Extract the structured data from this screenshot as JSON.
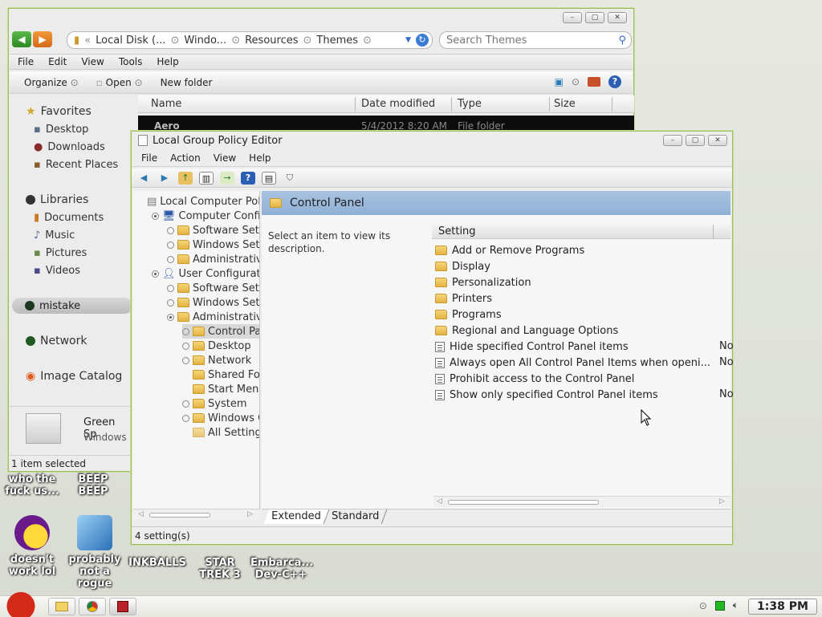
{
  "explorer": {
    "address": [
      "Local Disk (...",
      "Windo...",
      "Resources",
      "Themes"
    ],
    "search_placeholder": "Search Themes",
    "menu": [
      "File",
      "Edit",
      "View",
      "Tools",
      "Help"
    ],
    "toolbar": {
      "organize": "Organize",
      "open": "Open",
      "new_folder": "New folder"
    },
    "nav": {
      "favorites": "Favorites",
      "desktop": "Desktop",
      "downloads": "Downloads",
      "recent": "Recent Places",
      "libraries": "Libraries",
      "documents": "Documents",
      "music": "Music",
      "pictures": "Pictures",
      "videos": "Videos",
      "mistake": "mistake",
      "network": "Network",
      "image_catalog": "Image Catalog"
    },
    "columns": {
      "name": "Name",
      "date": "Date modified",
      "type": "Type",
      "size": "Size"
    },
    "row": {
      "name": "Aero",
      "date": "5/4/2012 8:20 AM",
      "type": "File folder"
    },
    "details": {
      "name": "Green Sp",
      "sub": "Windows"
    },
    "status": "1 item selected"
  },
  "gpe": {
    "title": "Local Group Policy Editor",
    "menu": [
      "File",
      "Action",
      "View",
      "Help"
    ],
    "tree": [
      {
        "label": "Local Computer Poli",
        "indent": 0,
        "toggle": "none",
        "icon": "doc"
      },
      {
        "label": "Computer Configu",
        "indent": 1,
        "toggle": "dot",
        "icon": "pc"
      },
      {
        "label": "Software Setti",
        "indent": 2,
        "toggle": "open",
        "icon": "folder"
      },
      {
        "label": "Windows Setti",
        "indent": 2,
        "toggle": "open",
        "icon": "folder"
      },
      {
        "label": "Administrative",
        "indent": 2,
        "toggle": "open",
        "icon": "folder"
      },
      {
        "label": "User Configuratio",
        "indent": 1,
        "toggle": "dot",
        "icon": "user"
      },
      {
        "label": "Software Setti",
        "indent": 2,
        "toggle": "open",
        "icon": "folder"
      },
      {
        "label": "Windows Setti",
        "indent": 2,
        "toggle": "open",
        "icon": "folder"
      },
      {
        "label": "Administrative",
        "indent": 2,
        "toggle": "dot",
        "icon": "folder"
      },
      {
        "label": "Control Par",
        "indent": 3,
        "toggle": "open",
        "icon": "folder",
        "selected": true
      },
      {
        "label": "Desktop",
        "indent": 3,
        "toggle": "open",
        "icon": "folder"
      },
      {
        "label": "Network",
        "indent": 3,
        "toggle": "open",
        "icon": "folder"
      },
      {
        "label": "Shared Fol",
        "indent": 3,
        "toggle": "none",
        "icon": "folder"
      },
      {
        "label": "Start Menu",
        "indent": 3,
        "toggle": "none",
        "icon": "folder"
      },
      {
        "label": "System",
        "indent": 3,
        "toggle": "open",
        "icon": "folder"
      },
      {
        "label": "Windows C",
        "indent": 3,
        "toggle": "open",
        "icon": "folder"
      },
      {
        "label": "All Settings",
        "indent": 3,
        "toggle": "none",
        "icon": "allsettings"
      }
    ],
    "panel_title": "Control Panel",
    "description": "Select an item to view its description.",
    "setting_header": "Setting",
    "settings": [
      {
        "label": "Add or Remove Programs",
        "kind": "folder",
        "state": ""
      },
      {
        "label": "Display",
        "kind": "folder",
        "state": ""
      },
      {
        "label": "Personalization",
        "kind": "folder",
        "state": ""
      },
      {
        "label": "Printers",
        "kind": "folder",
        "state": ""
      },
      {
        "label": "Programs",
        "kind": "folder",
        "state": ""
      },
      {
        "label": "Regional and Language Options",
        "kind": "folder",
        "state": ""
      },
      {
        "label": "Hide specified Control Panel items",
        "kind": "policy",
        "state": "No"
      },
      {
        "label": "Always open All Control Panel Items when openi...",
        "kind": "policy",
        "state": "No"
      },
      {
        "label": "Prohibit access to the Control Panel",
        "kind": "policy",
        "state": ""
      },
      {
        "label": "Show only specified Control Panel items",
        "kind": "policy",
        "state": "No"
      }
    ],
    "tabs": [
      "Extended",
      "Standard"
    ],
    "status": "4 setting(s)"
  },
  "desktop": {
    "icons": [
      {
        "label": "who the fuck us..."
      },
      {
        "label": "BEEP BEEP"
      },
      {
        "label": "doesn't work lol"
      },
      {
        "label": "probably not a rogue"
      },
      {
        "label": "INKBALLS"
      },
      {
        "label": "STAR TREK 3"
      },
      {
        "label": "Embarca... Dev-C++"
      }
    ]
  },
  "taskbar": {
    "clock": "1:38 PM"
  }
}
